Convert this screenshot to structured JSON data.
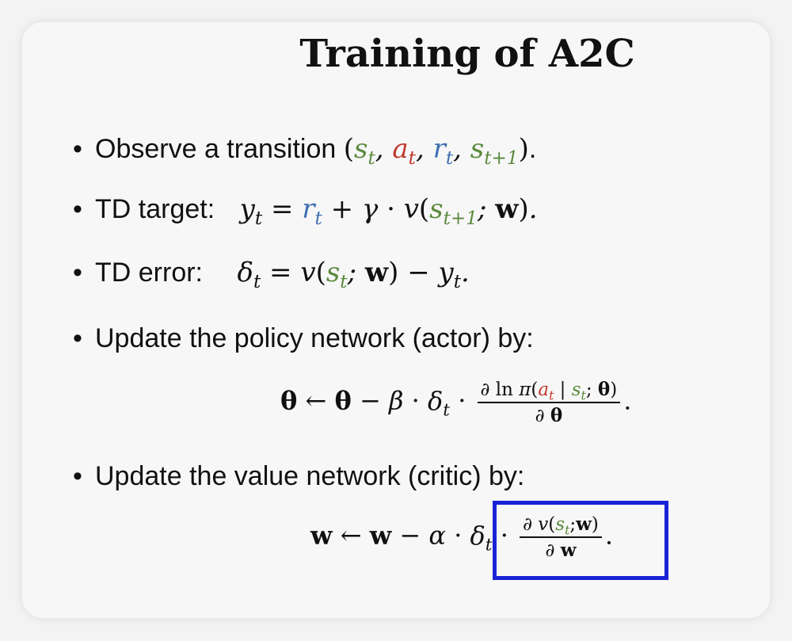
{
  "title": "Training of A2C",
  "bullets": {
    "observe_label": "Observe a transition",
    "td_target_label": "TD target:",
    "td_error_label": "TD error:",
    "actor_label": "Update the policy network (actor) by:",
    "critic_label": "Update the value network (critic) by:"
  },
  "colors": {
    "state": "#5b8a3c",
    "action": "#c0392b",
    "reward": "#3e6fb0",
    "highlight_box": "#1a22d6"
  }
}
